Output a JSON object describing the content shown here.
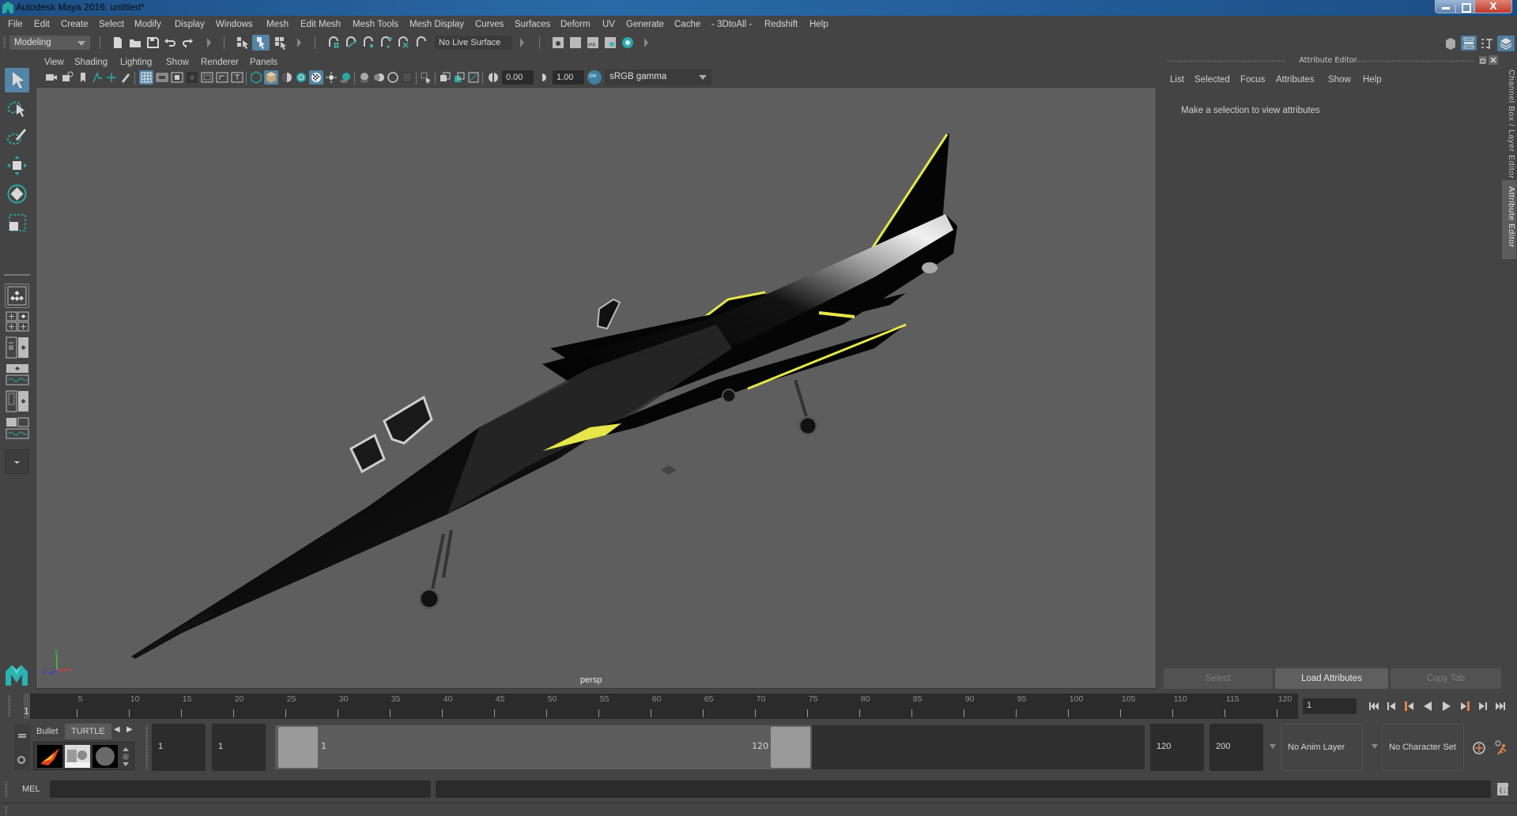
{
  "window": {
    "title": "Autodesk Maya 2016: untitled*",
    "close_glyph": "X"
  },
  "menubar": {
    "items": [
      "File",
      "Edit",
      "Create",
      "Select",
      "Modify",
      "Display",
      "Windows",
      "Mesh",
      "Edit Mesh",
      "Mesh Tools",
      "Mesh Display",
      "Curves",
      "Surfaces",
      "Deform",
      "UV",
      "Generate",
      "Cache",
      "- 3DtoAll -",
      "Redshift",
      "Help"
    ]
  },
  "statusline": {
    "menuset": "Modeling",
    "live_surface": "No Live Surface",
    "icons": [
      "new-scene-icon",
      "open-scene-icon",
      "save-scene-icon",
      "undo-icon",
      "redo-icon",
      "select-hierarchy-icon",
      "select-object-icon",
      "select-component-icon",
      "snap-grid-icon",
      "snap-curve-icon",
      "snap-point-icon",
      "snap-projected-center-icon",
      "snap-view-plane-icon",
      "make-live-icon",
      "render-view-icon",
      "render-current-icon",
      "ipr-render-icon",
      "render-settings-icon",
      "hypershade-icon"
    ],
    "right_icons": [
      "modeling-toolkit-icon",
      "attribute-editor-toggle-icon",
      "tool-settings-icon",
      "channel-box-icon"
    ]
  },
  "toolbox": {
    "tools": [
      "select-tool-icon",
      "lasso-tool-icon",
      "paint-select-tool-icon",
      "move-tool-icon",
      "rotate-tool-icon",
      "scale-tool-icon"
    ],
    "layouts": [
      "single-perspective-layout-icon",
      "four-view-layout-icon",
      "persp-outliner-layout-icon",
      "persp-graph-layout-icon",
      "outliner-persp-layout-icon",
      "persp-graph-hypershade-layout-icon",
      "more-layouts-icon"
    ]
  },
  "viewport": {
    "menus": [
      "View",
      "Shading",
      "Lighting",
      "Show",
      "Renderer",
      "Panels"
    ],
    "near_value": "0.00",
    "gamma_value": "1.00",
    "color_management": "sRGB gamma",
    "cm_badge": "ON",
    "camera": "persp",
    "axis": {
      "x": "x",
      "y": "y",
      "z": "z"
    },
    "colors": {
      "background": "#5e5e5e",
      "fuselage": "#0a0a0a",
      "accent": "#e6e64a",
      "highlight": "#e6e6e6"
    }
  },
  "attribute_editor": {
    "title": "Attribute Editor",
    "menus": [
      "List",
      "Selected",
      "Focus",
      "Attributes",
      "Show",
      "Help"
    ],
    "message": "Make a selection to view attributes",
    "buttons": [
      {
        "label": "Select",
        "enabled": false
      },
      {
        "label": "Load Attributes",
        "enabled": true
      },
      {
        "label": "Copy Tab",
        "enabled": false
      }
    ],
    "side_tabs": [
      {
        "label": "Channel Box / Layer Editor",
        "active": false
      },
      {
        "label": "Attribute Editor",
        "active": true
      }
    ]
  },
  "timeslider": {
    "current_frame": "1",
    "ticks": [
      "5",
      "10",
      "15",
      "20",
      "25",
      "30",
      "35",
      "40",
      "45",
      "50",
      "55",
      "60",
      "65",
      "70",
      "75",
      "80",
      "85",
      "90",
      "95",
      "100",
      "105",
      "110",
      "115",
      "120"
    ],
    "start_label": "1",
    "current_frame_field": "1",
    "playback_buttons": [
      "go-to-start-icon",
      "step-back-frame-icon",
      "step-back-key-icon",
      "play-backwards-icon",
      "play-forwards-icon",
      "step-forward-key-icon",
      "step-forward-frame-icon",
      "go-to-end-icon"
    ],
    "accent": "#e0834a"
  },
  "range_slider": {
    "shelf_tabs": [
      "Bullet",
      "TURTLE"
    ],
    "scene_start": "1",
    "playback_start": "1",
    "range_start_label": "1",
    "range_end_label": "120",
    "playback_end": "120",
    "scene_end": "200",
    "anim_layer": "No Anim Layer",
    "character_set": "No Character Set"
  },
  "command_line": {
    "mode": "MEL",
    "input": "",
    "output": ""
  }
}
